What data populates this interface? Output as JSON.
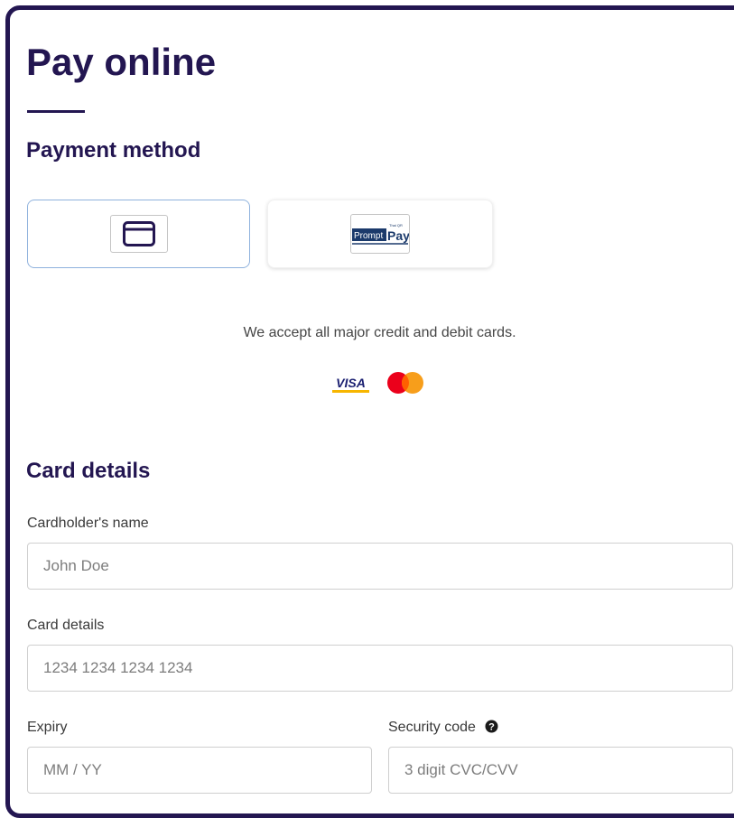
{
  "page": {
    "title": "Pay online"
  },
  "payment_method": {
    "heading": "Payment method",
    "options": [
      {
        "id": "card",
        "icon": "credit-card-icon",
        "selected": true
      },
      {
        "id": "promptpay",
        "icon": "promptpay-logo",
        "logo_text_left": "Prompt",
        "logo_text_right": "Pay",
        "logo_text_small": "Thai QR",
        "selected": false
      }
    ],
    "accept_text": "We accept all major credit and debit cards.",
    "brands": [
      {
        "name": "VISA",
        "icon": "visa-logo",
        "color": "#1a1f71",
        "stripe": "#f7b600"
      },
      {
        "name": "Mastercard",
        "icon": "mastercard-logo",
        "colors": [
          "#eb001b",
          "#f79e1b",
          "#ff5f00"
        ]
      }
    ]
  },
  "card_details": {
    "heading": "Card details",
    "cardholder": {
      "label": "Cardholder's name",
      "placeholder": "John Doe",
      "value": ""
    },
    "number": {
      "label": "Card details",
      "placeholder": "1234 1234 1234 1234",
      "value": ""
    },
    "expiry": {
      "label": "Expiry",
      "placeholder": "MM / YY",
      "value": ""
    },
    "security": {
      "label": "Security code",
      "placeholder": "3 digit CVC/CVV",
      "value": "",
      "help_icon": "question-circle-icon"
    }
  },
  "colors": {
    "brand": "#231651",
    "selected_border": "#8fb2dd"
  }
}
